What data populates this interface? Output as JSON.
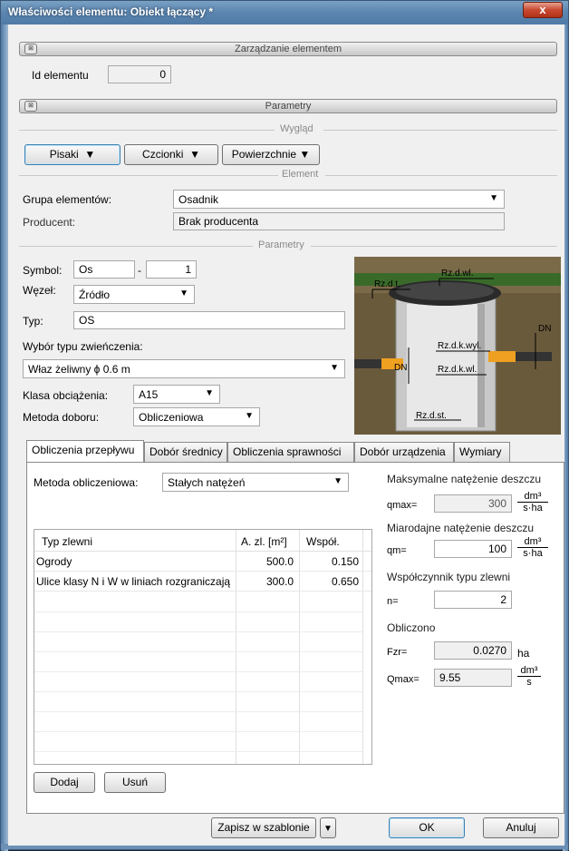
{
  "window": {
    "title": "Właściwości elementu: Obiekt łączący *",
    "close_glyph": "x"
  },
  "sections": {
    "management": "Zarządzanie elementem",
    "parameters": "Parametry",
    "collapse_glyph": "⊠"
  },
  "element_id": {
    "label": "Id elementu",
    "value": "0"
  },
  "appearance": {
    "header": "Wygląd",
    "pens": "Pisaki",
    "fonts": "Czcionki",
    "surfaces": "Powierzchnie"
  },
  "element": {
    "header": "Element",
    "group_label": "Grupa elementów:",
    "group_value": "Osadnik",
    "producer_label": "Producent:",
    "producer_value": "Brak producenta"
  },
  "params": {
    "header": "Parametry",
    "symbol_label": "Symbol:",
    "symbol_value": "Os",
    "symbol_sep": "-",
    "symbol_num": "1",
    "node_label": "Węzeł:",
    "node_value": "Źródło",
    "type_label": "Typ:",
    "type_value": "OS",
    "cap_label": "Wybór typu zwieńczenia:",
    "cap_value": "Właz żeliwny ϕ 0.6 m",
    "load_label": "Klasa obciążenia:",
    "load_value": "A15",
    "method_label": "Metoda doboru:",
    "method_value": "Obliczeniowa"
  },
  "diagram": {
    "labels": [
      "Rz.d.wl.",
      "Rz.d.t.",
      "DN",
      "Rz.d.k.wyl.",
      "DN",
      "Rz.d.k.wl.",
      "Rz.d.st."
    ]
  },
  "tabs": [
    "Obliczenia przepływu",
    "Dobór średnicy",
    "Obliczenia sprawności",
    "Dobór urządzenia",
    "Wymiary"
  ],
  "flow": {
    "method_label": "Metoda obliczeniowa:",
    "method_value": "Stałych natężeń",
    "table": {
      "headers": [
        "Typ zlewni",
        "A. zl. [m²]",
        "Współ."
      ],
      "rows": [
        [
          "Ogrody",
          "500.0",
          "0.150"
        ],
        [
          "Ulice klasy N i W w liniach rozgraniczają",
          "300.0",
          "0.650"
        ]
      ]
    },
    "add": "Dodaj",
    "remove": "Usuń",
    "qmax_header": "Maksymalne natężenie deszczu",
    "qmax_label": "qmax=",
    "qmax_value": "300",
    "qm_header": "Miarodajne natężenie deszczu",
    "qm_label": "qm=",
    "qm_value": "100",
    "unit_num": "dm³",
    "unit_den_ha": "s·ha",
    "n_header": "Współczynnik typu zlewni",
    "n_label": "n=",
    "n_value": "2",
    "calc_header": "Obliczono",
    "fzr_label": "Fzr=",
    "fzr_value": "0.0270",
    "fzr_unit": "ha",
    "Qmax_label": "Qmax=",
    "Qmax_value": "9.55",
    "Qmax_den": "s"
  },
  "footer": {
    "save_template": "Zapisz w szablonie",
    "ok": "OK",
    "cancel": "Anuluj"
  }
}
